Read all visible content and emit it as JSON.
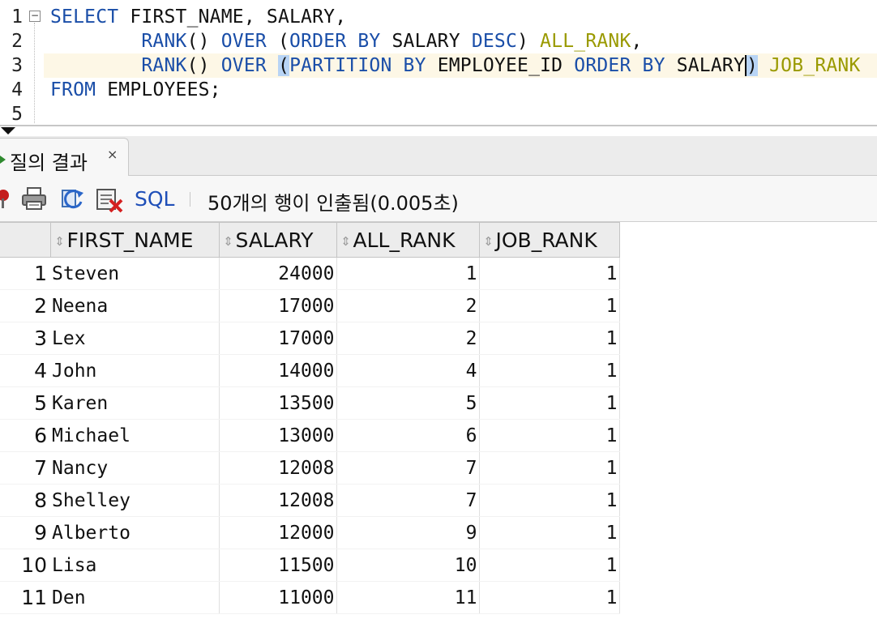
{
  "editor": {
    "line_numbers": [
      "1",
      "2",
      "3",
      "4",
      "5"
    ],
    "fold_marker": "−",
    "lines": [
      [
        {
          "t": "SELECT",
          "c": "kw"
        },
        {
          "t": " FIRST_NAME, SALARY,",
          "c": ""
        }
      ],
      [
        {
          "t": "        RANK",
          "c": "kw"
        },
        {
          "t": "() ",
          "c": ""
        },
        {
          "t": "OVER",
          "c": "kw"
        },
        {
          "t": " (",
          "c": ""
        },
        {
          "t": "ORDER BY",
          "c": "kw"
        },
        {
          "t": " SALARY ",
          "c": ""
        },
        {
          "t": "DESC",
          "c": "kw"
        },
        {
          "t": ") ",
          "c": ""
        },
        {
          "t": "ALL_RANK",
          "c": "al"
        },
        {
          "t": ",",
          "c": ""
        }
      ],
      [
        {
          "t": "        RANK",
          "c": "kw"
        },
        {
          "t": "() ",
          "c": ""
        },
        {
          "t": "OVER",
          "c": "kw"
        },
        {
          "t": " ",
          "c": ""
        },
        {
          "t": "(",
          "c": "hl"
        },
        {
          "t": "PARTITION BY",
          "c": "kw"
        },
        {
          "t": " EMPLOYEE_ID ",
          "c": ""
        },
        {
          "t": "ORDER BY",
          "c": "kw"
        },
        {
          "t": " SALARY",
          "c": "caret"
        },
        {
          "t": ")",
          "c": "hl"
        },
        {
          "t": " ",
          "c": ""
        },
        {
          "t": "JOB_RANK",
          "c": "al"
        }
      ],
      [
        {
          "t": "FROM",
          "c": "kw"
        },
        {
          "t": " EMPLOYEES;",
          "c": ""
        }
      ],
      [
        {
          "t": "",
          "c": ""
        }
      ]
    ]
  },
  "results_tab": {
    "label": "질의 결과",
    "close": "×"
  },
  "toolbar": {
    "sql_label": "SQL",
    "separator": "|",
    "status": "50개의 행이 인출됨(0.005초)"
  },
  "grid": {
    "columns": [
      "FIRST_NAME",
      "SALARY",
      "ALL_RANK",
      "JOB_RANK"
    ],
    "rows": [
      [
        "1",
        "Steven",
        "24000",
        "1",
        "1"
      ],
      [
        "2",
        "Neena",
        "17000",
        "2",
        "1"
      ],
      [
        "3",
        "Lex",
        "17000",
        "2",
        "1"
      ],
      [
        "4",
        "John",
        "14000",
        "4",
        "1"
      ],
      [
        "5",
        "Karen",
        "13500",
        "5",
        "1"
      ],
      [
        "6",
        "Michael",
        "13000",
        "6",
        "1"
      ],
      [
        "7",
        "Nancy",
        "12008",
        "7",
        "1"
      ],
      [
        "8",
        "Shelley",
        "12008",
        "7",
        "1"
      ],
      [
        "9",
        "Alberto",
        "12000",
        "9",
        "1"
      ],
      [
        "10",
        "Lisa",
        "11500",
        "10",
        "1"
      ],
      [
        "11",
        "Den",
        "11000",
        "11",
        "1"
      ]
    ]
  },
  "icons": [
    "pin-icon",
    "print-icon",
    "refresh-icon",
    "clear-icon"
  ],
  "colors": {
    "keyword": "#1a4ea8",
    "alias": "#9a9a00",
    "bracket_highlight": "#b8d4f5",
    "current_line": "#fdf7e6",
    "sql_link": "#1f4fb8"
  }
}
